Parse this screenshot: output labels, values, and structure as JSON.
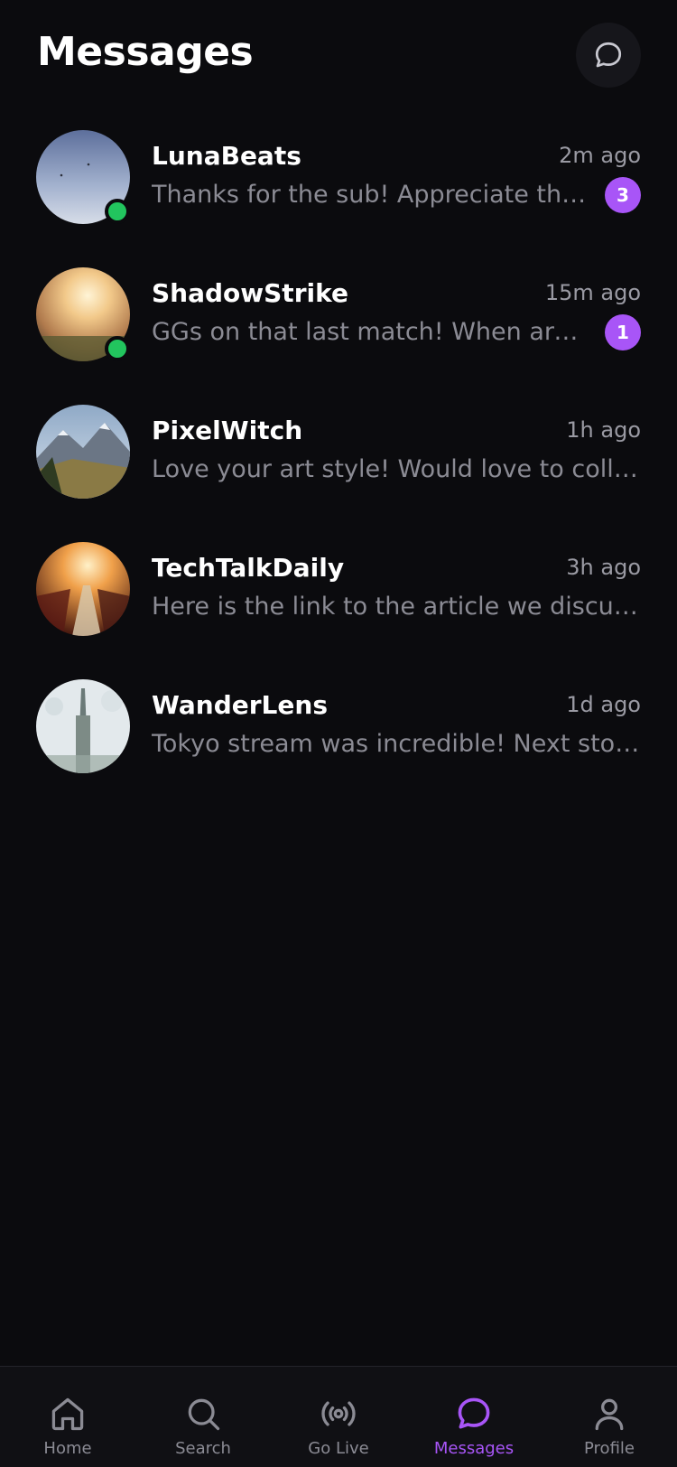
{
  "header": {
    "title": "Messages",
    "compose_icon": "chat-bubble-icon"
  },
  "conversations": [
    {
      "name": "LunaBeats",
      "time": "2m ago",
      "preview": "Thanks for the sub! Appreciate the support",
      "unread": "3",
      "online": true
    },
    {
      "name": "ShadowStrike",
      "time": "15m ago",
      "preview": "GGs on that last match! When are you streaming next?",
      "unread": "1",
      "online": true
    },
    {
      "name": "PixelWitch",
      "time": "1h ago",
      "preview": "Love your art style! Would love to collab sometime",
      "unread": "",
      "online": false
    },
    {
      "name": "TechTalkDaily",
      "time": "3h ago",
      "preview": "Here is the link to the article we discussed",
      "unread": "",
      "online": false
    },
    {
      "name": "WanderLens",
      "time": "1d ago",
      "preview": "Tokyo stream was incredible! Next stop: London",
      "unread": "",
      "online": false
    }
  ],
  "tabbar": {
    "items": [
      {
        "label": "Home",
        "icon": "home-icon",
        "active": false
      },
      {
        "label": "Search",
        "icon": "search-icon",
        "active": false
      },
      {
        "label": "Go Live",
        "icon": "broadcast-icon",
        "active": false
      },
      {
        "label": "Messages",
        "icon": "chat-bubble-icon",
        "active": true
      },
      {
        "label": "Profile",
        "icon": "user-icon",
        "active": false
      }
    ]
  },
  "colors": {
    "background": "#0b0b0e",
    "accent": "#a855f7",
    "online": "#22c55e",
    "muted_text": "#8b8b94"
  }
}
